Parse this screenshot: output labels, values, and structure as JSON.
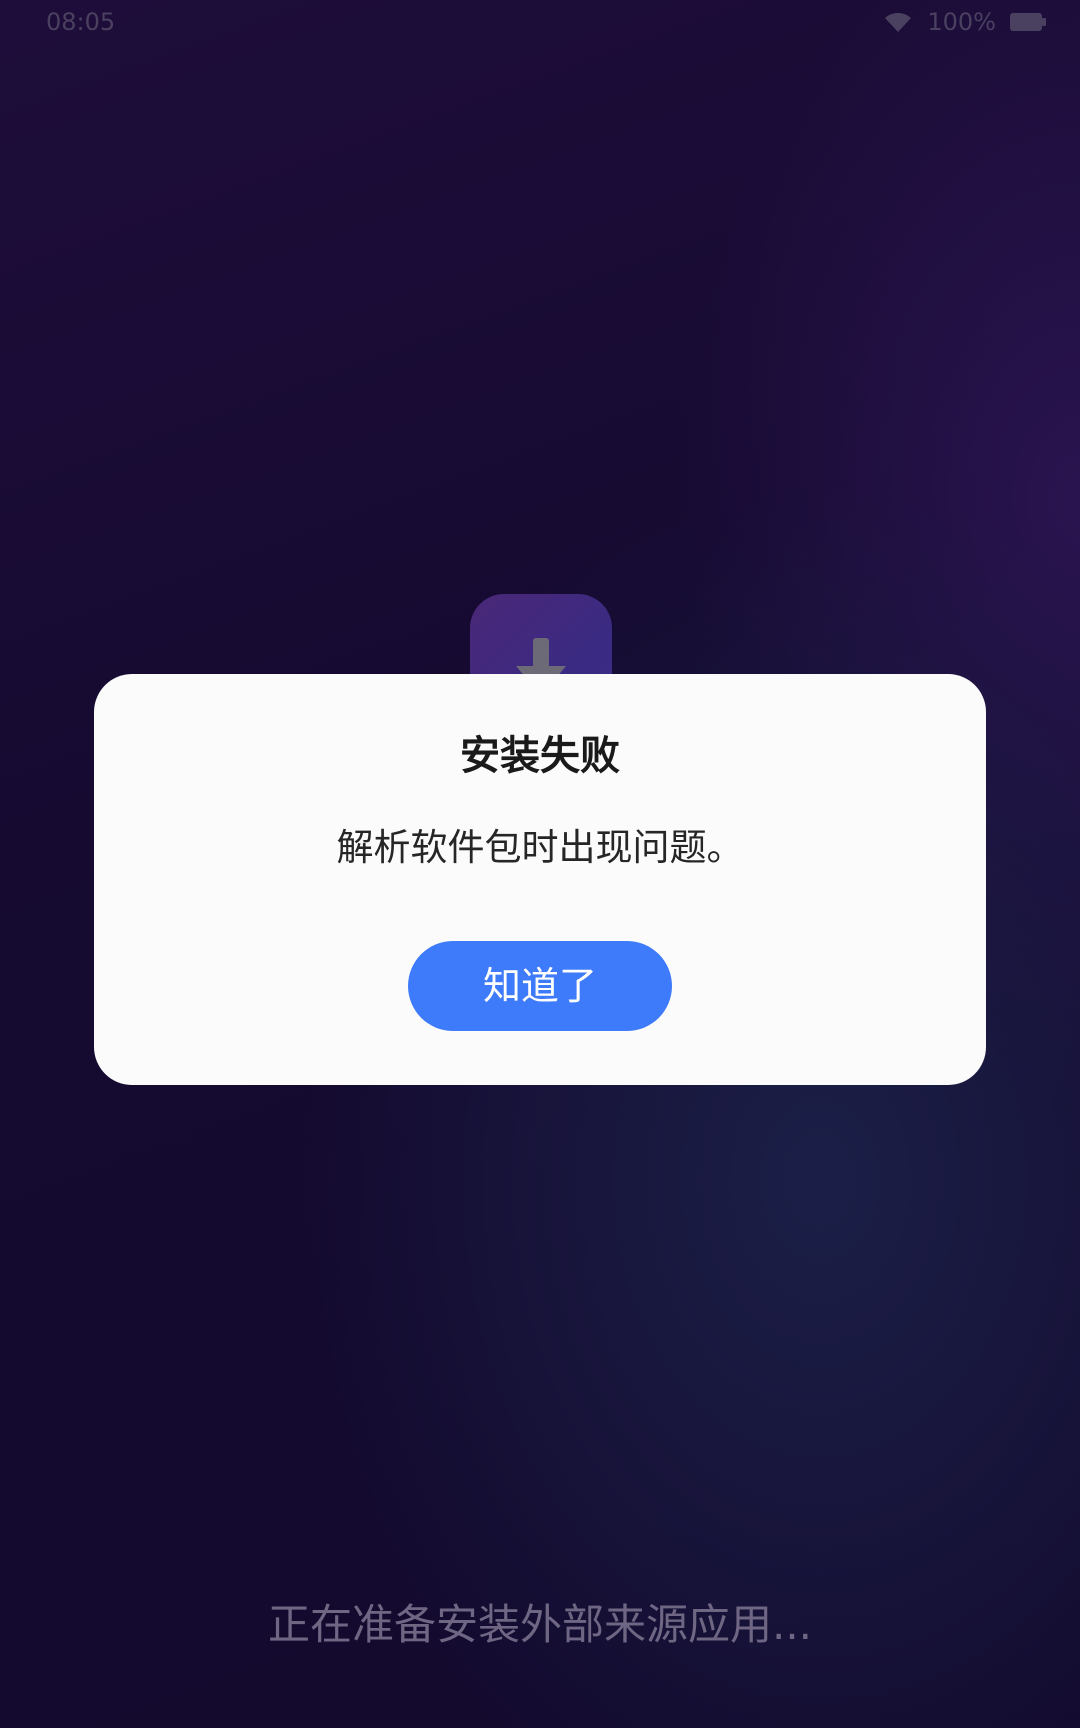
{
  "status_bar": {
    "time": "08:05",
    "battery": "100%"
  },
  "dialog": {
    "title": "安装失败",
    "message": "解析软件包时出现问题。",
    "ok_label": "知道了"
  },
  "footer": {
    "status_text": "正在准备安装外部来源应用..."
  },
  "colors": {
    "button": "#3d7bfb",
    "dialog_background": "#fbfbfb"
  },
  "icons": [
    "wifi-icon",
    "battery-icon",
    "download-arrow-icon"
  ]
}
